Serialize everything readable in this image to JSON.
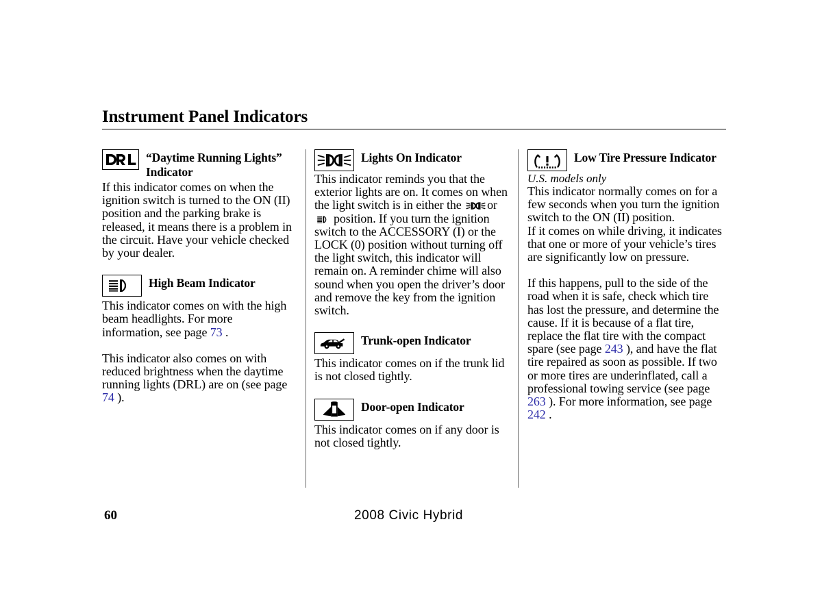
{
  "page": {
    "title": "Instrument Panel Indicators",
    "folio": "60",
    "footer_model": "2008  Civic  Hybrid",
    "link_color": "#2b2ba8"
  },
  "columns": {
    "left": {
      "entries": [
        {
          "icon": "drl-indicator-icon",
          "icon_text": "DRL",
          "title": "“Daytime Running Lights” Indicator",
          "paragraphs": [
            "If this indicator comes on when the ignition switch is turned to the ON (II) position and the parking brake is released, it means there is a problem in the circuit. Have your vehicle checked by your dealer."
          ]
        },
        {
          "icon": "high-beam-indicator-icon",
          "title": "High Beam Indicator",
          "paragraph_1_pre": "This indicator comes on with the high beam headlights. For more information, see page ",
          "paragraph_1_page": "73",
          "paragraph_1_post": " .",
          "paragraph_2_pre": "This indicator also comes on with reduced brightness when the daytime running lights (DRL) are on (see page ",
          "paragraph_2_page": "74",
          "paragraph_2_post": " )."
        }
      ]
    },
    "middle": {
      "entries": [
        {
          "icon": "lights-on-indicator-icon",
          "title": "Lights On Indicator",
          "text_part_1": "This indicator reminds you that the exterior lights are on. It comes on when the light switch is in either the",
          "text_part_2": "or",
          "text_part_3": "position. If you turn the ignition switch to the ACCESSORY (I) or the LOCK (0) position without turning off the light switch, this indicator will remain on. A reminder chime will also sound when you open the driver’s door and remove the key from the ignition switch."
        },
        {
          "icon": "trunk-open-indicator-icon",
          "title": "Trunk-open Indicator",
          "paragraphs": [
            "This indicator comes on if the trunk lid is not closed tightly."
          ]
        },
        {
          "icon": "door-open-indicator-icon",
          "title": "Door-open Indicator",
          "paragraphs": [
            "This indicator comes on if any door is not closed tightly."
          ]
        }
      ]
    },
    "right": {
      "entries": [
        {
          "icon": "low-tire-pressure-indicator-icon",
          "title": "Low Tire Pressure Indicator",
          "subnote": "U.S. models only",
          "paragraph_1": "This indicator normally comes on for a few seconds when you turn the ignition switch to the ON (II) position.",
          "paragraph_2": "If it comes on while driving, it indicates that one or more of your vehicle’s tires are significantly low on pressure.",
          "paragraph_3_pre": "If this happens, pull to the side of the road when it is safe, check which tire has lost the pressure, and determine the cause. If it is because of a flat tire, replace the flat tire with the compact spare (see page ",
          "paragraph_3_page_a": "243",
          "paragraph_3_mid": " ), and have the flat tire repaired as soon as possible. If two or more tires are underinflated, call a professional towing service (see page ",
          "paragraph_3_page_b": "263",
          "paragraph_3_mid_2": " ). For more information, see page ",
          "paragraph_3_page_c": "242",
          "paragraph_3_post": " ."
        }
      ]
    }
  }
}
